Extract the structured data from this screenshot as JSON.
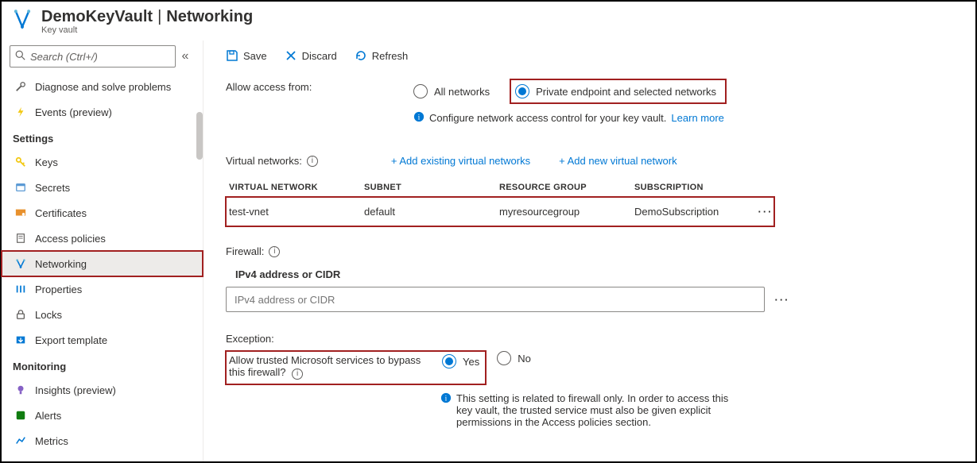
{
  "header": {
    "resource": "DemoKeyVault",
    "blade": "Networking",
    "type": "Key vault"
  },
  "sidebar": {
    "search_placeholder": "Search (Ctrl+/)",
    "top": [
      {
        "icon": "wrench",
        "label": "Diagnose and solve problems"
      },
      {
        "icon": "bolt",
        "label": "Events (preview)"
      }
    ],
    "sections": [
      {
        "title": "Settings",
        "items": [
          {
            "icon": "key",
            "label": "Keys"
          },
          {
            "icon": "secret",
            "label": "Secrets"
          },
          {
            "icon": "cert",
            "label": "Certificates"
          },
          {
            "icon": "policy",
            "label": "Access policies"
          },
          {
            "icon": "net",
            "label": "Networking",
            "selected": true
          },
          {
            "icon": "props",
            "label": "Properties"
          },
          {
            "icon": "lock",
            "label": "Locks"
          },
          {
            "icon": "export",
            "label": "Export template"
          }
        ]
      },
      {
        "title": "Monitoring",
        "items": [
          {
            "icon": "insights",
            "label": "Insights (preview)"
          },
          {
            "icon": "alerts",
            "label": "Alerts"
          },
          {
            "icon": "metrics",
            "label": "Metrics"
          }
        ]
      }
    ]
  },
  "toolbar": {
    "save": "Save",
    "discard": "Discard",
    "refresh": "Refresh"
  },
  "access": {
    "label": "Allow access from:",
    "option_all": "All networks",
    "option_private": "Private endpoint and selected networks",
    "hint": "Configure network access control for your key vault.",
    "learn": "Learn more"
  },
  "vnet": {
    "label": "Virtual networks:",
    "add_existing": "+ Add existing virtual networks",
    "add_new": "+ Add new virtual network",
    "columns": {
      "c1": "VIRTUAL NETWORK",
      "c2": "SUBNET",
      "c3": "RESOURCE GROUP",
      "c4": "SUBSCRIPTION"
    },
    "rows": [
      {
        "vnet": "test-vnet",
        "subnet": "default",
        "rg": "myresourcegroup",
        "sub": "DemoSubscription"
      }
    ]
  },
  "firewall": {
    "label": "Firewall:",
    "ipv4_label": "IPv4 address or CIDR",
    "ipv4_placeholder": "IPv4 address or CIDR"
  },
  "exception": {
    "heading": "Exception:",
    "question": "Allow trusted Microsoft services to bypass this firewall?",
    "yes": "Yes",
    "no": "No",
    "note": "This setting is related to firewall only. In order to access this key vault, the trusted service must also be given explicit permissions in the Access policies section."
  }
}
